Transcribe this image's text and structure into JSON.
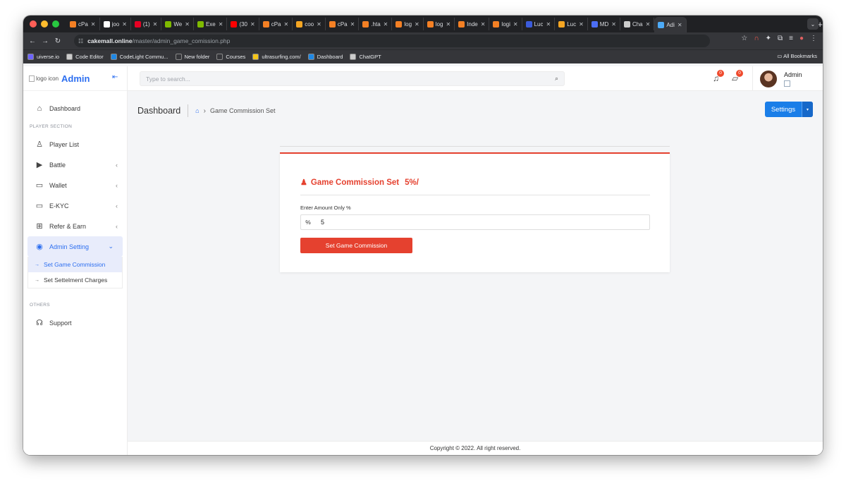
{
  "browser": {
    "tabs": [
      {
        "label": "cPa",
        "color": "#f48024"
      },
      {
        "label": "joo",
        "color": "#ffffff"
      },
      {
        "label": "(1)",
        "color": "#e60023"
      },
      {
        "label": "We",
        "color": "#7fba00"
      },
      {
        "label": "Exe",
        "color": "#7fba00"
      },
      {
        "label": "(30",
        "color": "#ff0000"
      },
      {
        "label": "cPa",
        "color": "#f48024"
      },
      {
        "label": "coo",
        "color": "#f5a623"
      },
      {
        "label": "cPa",
        "color": "#f48024"
      },
      {
        "label": ".hta",
        "color": "#f48024"
      },
      {
        "label": "log",
        "color": "#f48024"
      },
      {
        "label": "log",
        "color": "#f48024"
      },
      {
        "label": "Inde",
        "color": "#f48024"
      },
      {
        "label": "logi",
        "color": "#f48024"
      },
      {
        "label": "Luc",
        "color": "#3b5bdb"
      },
      {
        "label": "Luc",
        "color": "#f5a623"
      },
      {
        "label": "MD",
        "color": "#4c6ef5"
      },
      {
        "label": "Cha",
        "color": "#cccccc"
      },
      {
        "label": "Adi",
        "color": "#4dabf7",
        "active": true
      }
    ],
    "new_tab": "+",
    "url_host": "cakemall.online",
    "url_path": "/master/admin_game_comission.php",
    "bookmarks": [
      {
        "label": "uiverse.io",
        "color": "#6c63ff"
      },
      {
        "label": "Code Editor",
        "color": "#cccccc"
      },
      {
        "label": "CodeLight Commu...",
        "color": "#1e88e5"
      },
      {
        "label": "New folder",
        "color": "#35363a"
      },
      {
        "label": "Courses",
        "color": "#35363a"
      },
      {
        "label": "ultrasurfing.com/",
        "color": "#f5c518"
      },
      {
        "label": "Dashboard",
        "color": "#1e88e5"
      },
      {
        "label": "ChatGPT",
        "color": "#cccccc"
      }
    ],
    "all_bookmarks": "All Bookmarks"
  },
  "sidebar": {
    "logo_alt": "logo icon",
    "brand": "Admin",
    "dashboard": "Dashboard",
    "section_player": "PLAYER SECTION",
    "items": [
      {
        "label": "Player List",
        "icon": "user-icon",
        "glyph": "♙",
        "chev": ""
      },
      {
        "label": "Battle",
        "icon": "play-icon",
        "glyph": "▶",
        "chev": "‹"
      },
      {
        "label": "Wallet",
        "icon": "wallet-icon",
        "glyph": "▭",
        "chev": "‹"
      },
      {
        "label": "E-KYC",
        "icon": "kyc-icon",
        "glyph": "▭",
        "chev": "‹"
      },
      {
        "label": "Refer & Earn",
        "icon": "gift-icon",
        "glyph": "⊞",
        "chev": "‹"
      }
    ],
    "admin_setting": "Admin Setting",
    "sub_items": [
      {
        "label": "Set Game Commission"
      },
      {
        "label": "Set Settelment Charges"
      }
    ],
    "section_others": "OTHERS",
    "support": "Support"
  },
  "topbar": {
    "search_placeholder": "Type to search...",
    "notif_count": "0",
    "msg_count": "0",
    "admin_name": "Admin"
  },
  "breadcrumb": {
    "title": "Dashboard",
    "current": "Game Commission Set"
  },
  "settings_button": "Settings",
  "card": {
    "title": "Game Commission Set",
    "title_value": "5%/",
    "field_label": "Enter Amount Only %",
    "prefix": "%",
    "value": "5",
    "submit": "Set Game Commission"
  },
  "footer": "Copyright © 2022. All right reserved.",
  "colors": {
    "accent": "#2d6ff0",
    "danger": "#e5412f",
    "settings": "#1a7ee8"
  }
}
